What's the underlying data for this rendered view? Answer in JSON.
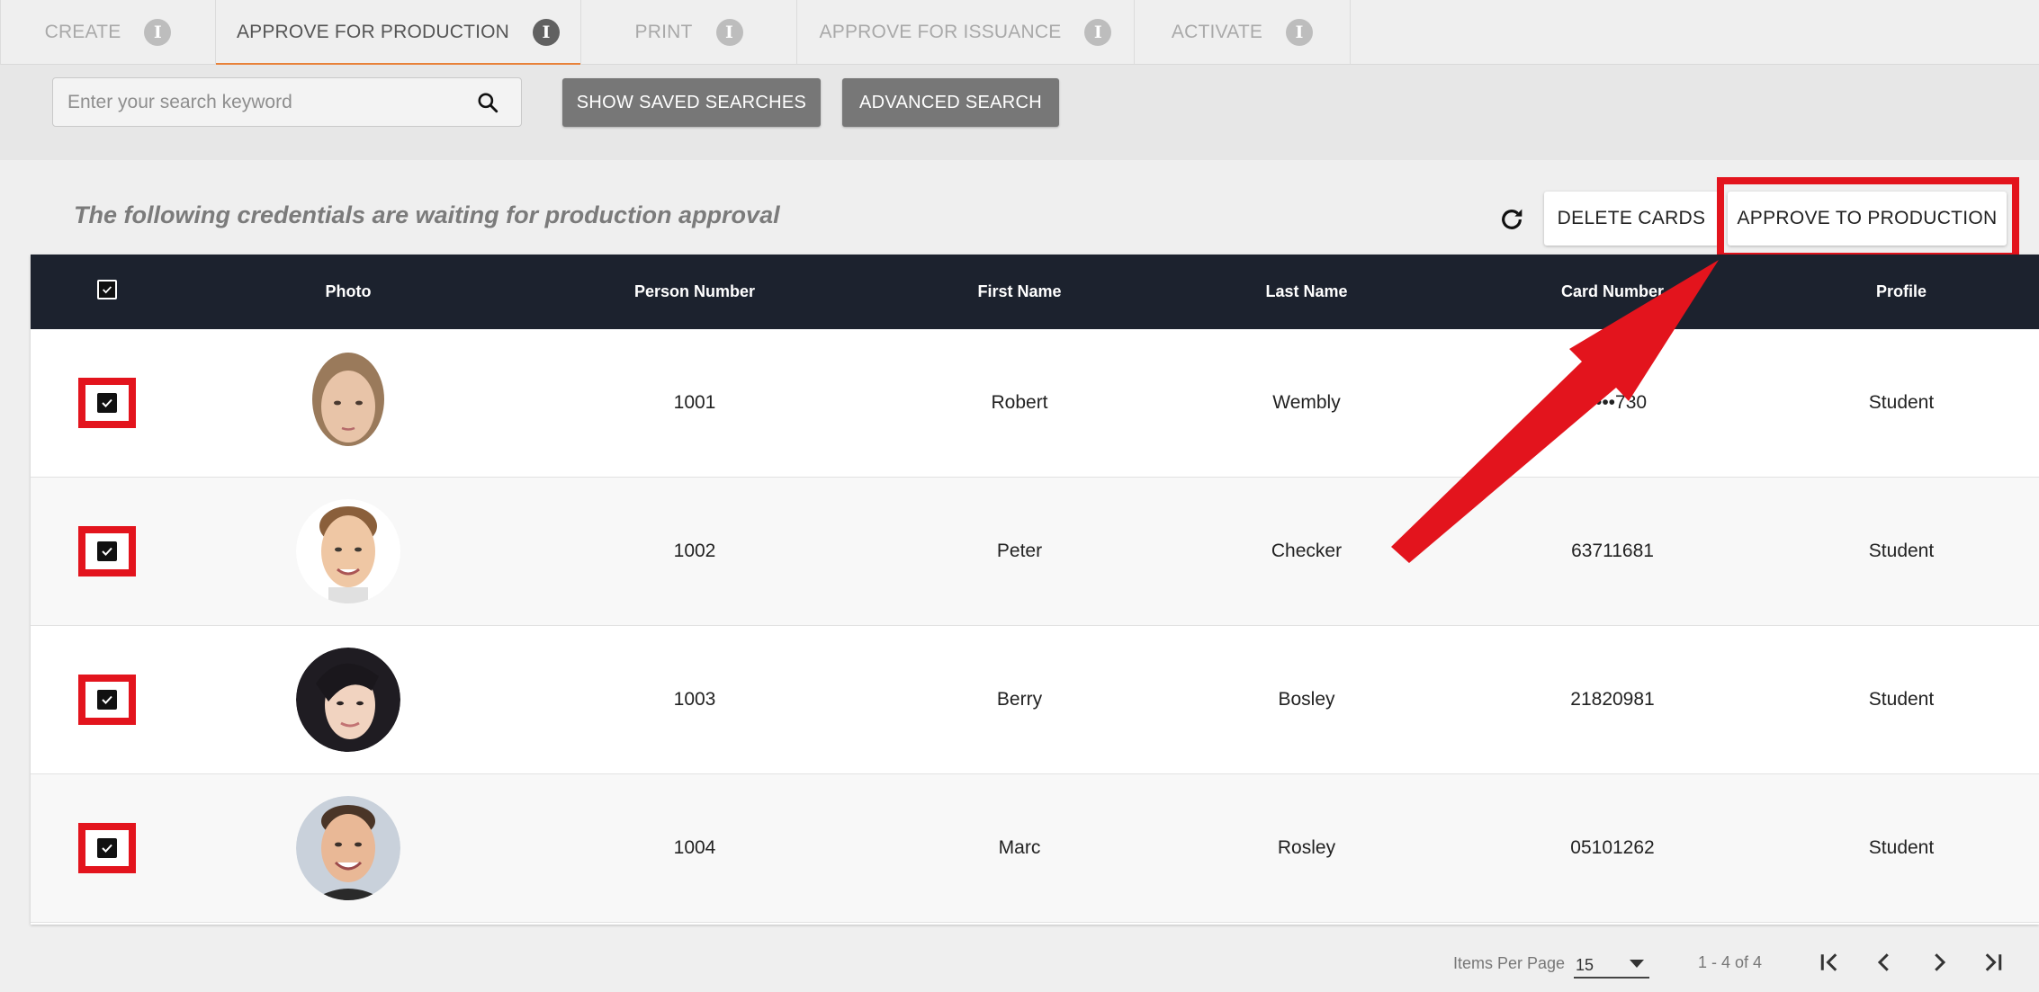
{
  "tabs": [
    {
      "label": "CREATE",
      "active": false
    },
    {
      "label": "APPROVE FOR PRODUCTION",
      "active": true
    },
    {
      "label": "PRINT",
      "active": false
    },
    {
      "label": "APPROVE FOR ISSUANCE",
      "active": false
    },
    {
      "label": "ACTIVATE",
      "active": false
    }
  ],
  "search": {
    "placeholder": "Enter your search keyword",
    "show_saved_label": "SHOW SAVED SEARCHES",
    "advanced_label": "ADVANCED SEARCH"
  },
  "main": {
    "title": "The following credentials are waiting for production approval",
    "delete_label": "DELETE CARDS",
    "approve_label": "APPROVE TO PRODUCTION"
  },
  "table": {
    "headers": [
      "Photo",
      "Person Number",
      "First Name",
      "Last Name",
      "Card Number",
      "Profile"
    ],
    "rows": [
      {
        "person_number": "1001",
        "first_name": "Robert",
        "last_name": "Wembly",
        "card_number": "5••••730",
        "profile": "Student",
        "checked": true
      },
      {
        "person_number": "1002",
        "first_name": "Peter",
        "last_name": "Checker",
        "card_number": "63711681",
        "profile": "Student",
        "checked": true
      },
      {
        "person_number": "1003",
        "first_name": "Berry",
        "last_name": "Bosley",
        "card_number": "21820981",
        "profile": "Student",
        "checked": true
      },
      {
        "person_number": "1004",
        "first_name": "Marc",
        "last_name": "Rosley",
        "card_number": "05101262",
        "profile": "Student",
        "checked": true
      }
    ]
  },
  "pagination": {
    "items_per_page_label": "Items Per Page",
    "items_per_page_value": "15",
    "range": "1 - 4 of 4"
  },
  "colors": {
    "accent_orange": "#e8823a",
    "annotation_red": "#e3141d",
    "table_header": "#1c222e"
  }
}
